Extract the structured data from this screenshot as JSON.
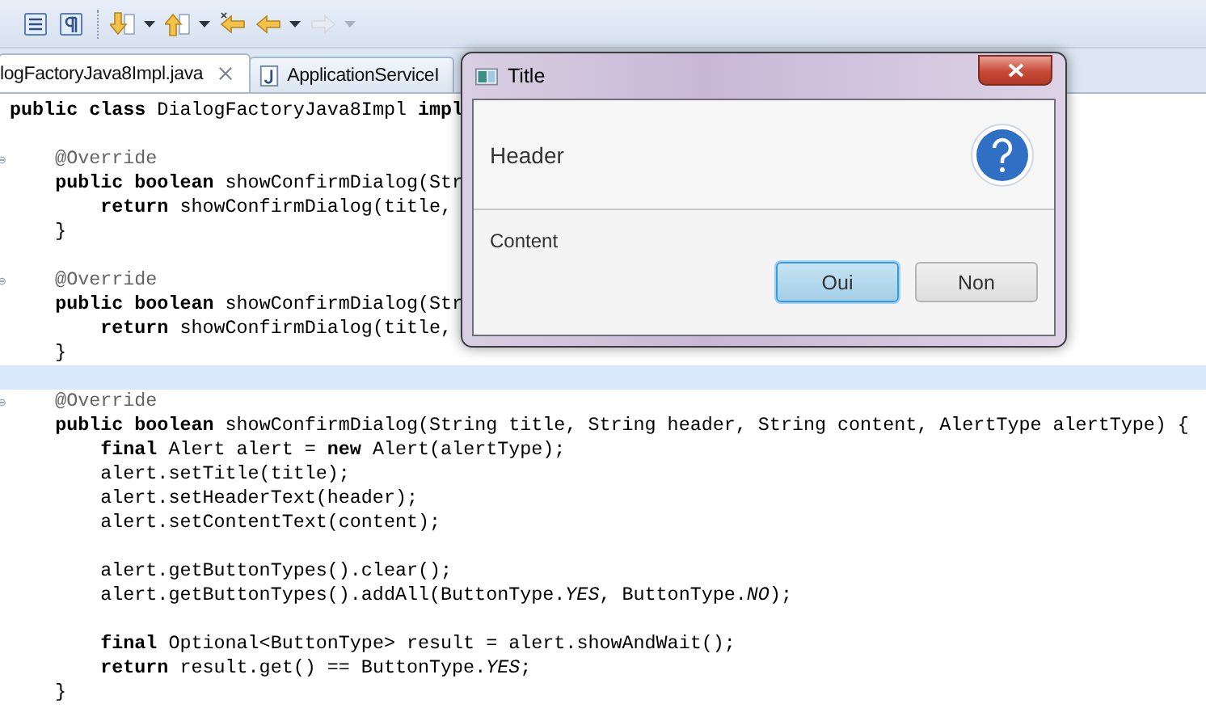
{
  "toolbar": [
    {
      "kind": "outline",
      "disabled": false,
      "menu": false
    },
    {
      "kind": "pilcrow",
      "disabled": false,
      "menu": false
    },
    {
      "kind": "next-annotation",
      "disabled": false,
      "menu": true
    },
    {
      "kind": "prev-annotation",
      "disabled": false,
      "menu": true
    },
    {
      "kind": "last-edit",
      "disabled": false,
      "menu": false
    },
    {
      "kind": "back",
      "disabled": false,
      "menu": true
    },
    {
      "kind": "forward",
      "disabled": true,
      "menu": true
    }
  ],
  "tabs": [
    {
      "label": "logFactoryJava8Impl.java",
      "selected": true,
      "closable": true
    },
    {
      "label": "ApplicationServiceI",
      "selected": false,
      "closable": false
    }
  ],
  "editor": {
    "lines": [
      {
        "current": false,
        "fold": false,
        "text": "**public class** DialogFactoryJava8Impl **impl**"
      },
      {
        "current": false,
        "fold": false
      },
      {
        "current": false,
        "fold": true,
        "text": "    @Override"
      },
      {
        "current": false,
        "fold": false,
        "text": "    **public boolean** showConfirmDialog(Str"
      },
      {
        "current": false,
        "fold": false,
        "text": "        **return** showConfirmDialog(title,"
      },
      {
        "current": false,
        "fold": false,
        "text": "    }"
      },
      {
        "current": false,
        "fold": false
      },
      {
        "current": false,
        "fold": true,
        "text": "    @Override"
      },
      {
        "current": false,
        "fold": false,
        "text": "    **public boolean** showConfirmDialog(Str"
      },
      {
        "current": false,
        "fold": false,
        "text": "        **return** showConfirmDialog(title,"
      },
      {
        "current": false,
        "fold": false,
        "text": "    }"
      },
      {
        "current": true,
        "fold": false
      },
      {
        "current": false,
        "fold": true,
        "text": "    @Override"
      },
      {
        "current": false,
        "fold": false,
        "text": "    **public boolean** showConfirmDialog(String title, String header, String content, AlertType alertType) {"
      },
      {
        "current": false,
        "fold": false,
        "text": "        **final** Alert alert = **new** Alert(alertType);"
      },
      {
        "current": false,
        "fold": false,
        "text": "        alert.setTitle(title);"
      },
      {
        "current": false,
        "fold": false,
        "text": "        alert.setHeaderText(header);"
      },
      {
        "current": false,
        "fold": false,
        "text": "        alert.setContentText(content);"
      },
      {
        "current": false,
        "fold": false
      },
      {
        "current": false,
        "fold": false,
        "text": "        alert.getButtonTypes().clear();"
      },
      {
        "current": false,
        "fold": false,
        "text": "        alert.getButtonTypes().addAll(ButtonType.*YES*, ButtonType.*NO*);"
      },
      {
        "current": false,
        "fold": false
      },
      {
        "current": false,
        "fold": false,
        "text": "        **final** Optional<ButtonType> result = alert.showAndWait();"
      },
      {
        "current": false,
        "fold": false,
        "text": "        **return** result.get() == ButtonType.*YES*;"
      },
      {
        "current": false,
        "fold": false,
        "text": "    }"
      }
    ]
  },
  "dialog": {
    "title": "Title",
    "header": "Header",
    "content": "Content",
    "buttons": [
      {
        "label": "Oui",
        "default": true
      },
      {
        "label": "Non",
        "default": false
      }
    ]
  }
}
